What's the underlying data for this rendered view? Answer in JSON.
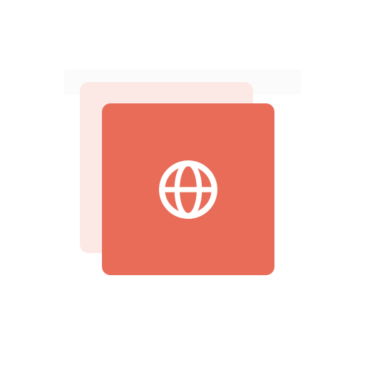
{
  "icon": {
    "name": "globe-icon"
  },
  "colors": {
    "background": "#ffffff",
    "top_strip": "#fbfbfb",
    "back_card": "#fce9e6",
    "front_card": "#e96c59",
    "icon_stroke": "#ffffff"
  }
}
